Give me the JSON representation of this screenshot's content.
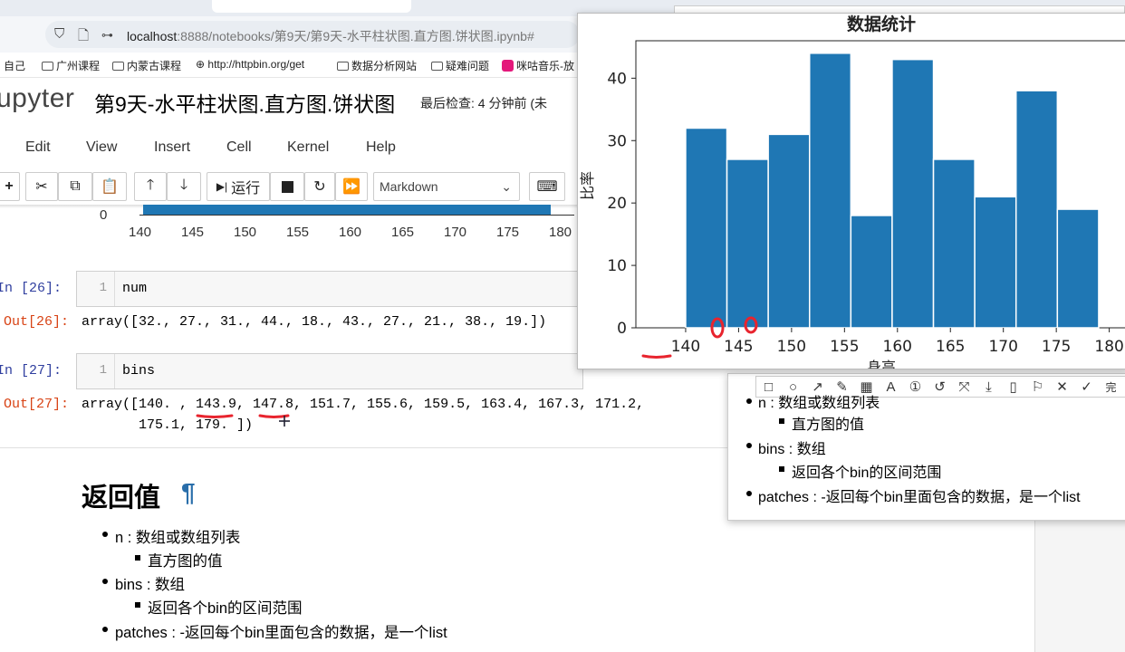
{
  "browser": {
    "url_host": "localhost",
    "url_rest": ":8888/notebooks/第9天/第9天-水平柱状图.直方图.饼状图.ipynb#",
    "bookmarks": [
      "自己",
      "广州课程",
      "内蒙古课程",
      "http://httpbin.org/get",
      "数据分析网站",
      "疑难问题",
      "咪咕音乐-放"
    ]
  },
  "jupyter": {
    "logo": "upyter",
    "title": "第9天-水平柱状图.直方图.饼状图",
    "checkpoint": "最后检查: 4 分钟前  (未",
    "menu": [
      "Edit",
      "View",
      "Insert",
      "Cell",
      "Kernel",
      "Help"
    ],
    "toolbar": {
      "run_label": "运行",
      "cell_type": "Markdown"
    }
  },
  "top_plot": {
    "zero_label": "0",
    "ticks": [
      "140",
      "145",
      "150",
      "155",
      "160",
      "165",
      "170",
      "175",
      "180"
    ]
  },
  "cells": [
    {
      "in_prompt": "In  [26]:",
      "line_no": "1",
      "code": "num",
      "out_prompt": "Out[26]:",
      "output": "array([32., 27., 31., 44., 18., 43., 27., 21., 38., 19.])"
    },
    {
      "in_prompt": "In  [27]:",
      "line_no": "1",
      "code": "bins",
      "out_prompt": "Out[27]:",
      "output_line1": "array([140. , 143.9, 147.8, 151.7, 155.6, 159.5, 163.4, 167.3, 171.2,",
      "output_line2": "       175.1, 179. ])"
    }
  ],
  "markdown": {
    "heading": "返回值",
    "pilcrow": "¶",
    "items": [
      {
        "term": "n : 数组或数组列表",
        "sub": "直方图的值"
      },
      {
        "term": "bins : 数组",
        "sub": "返回各个bin的区间范围"
      },
      {
        "term": "patches : -返回每个bin里面包含的数据，是一个list",
        "sub": ""
      }
    ]
  },
  "copy_window": {
    "items": [
      {
        "term": "n : 数组或数组列表",
        "sub": "直方图的值"
      },
      {
        "term": "bins : 数组",
        "sub": "返回各个bin的区间范围"
      },
      {
        "term": "patches : -返回每个bin里面包含的数据，是一个list",
        "sub": ""
      }
    ],
    "snip_done": "完"
  },
  "chart_data": {
    "type": "bar",
    "title": "数据统计",
    "xlabel": "身高",
    "ylabel": "比率",
    "bins": [
      140.0,
      143.9,
      147.8,
      151.7,
      155.6,
      159.5,
      163.4,
      167.3,
      171.2,
      175.1,
      179.0
    ],
    "values": [
      32,
      27,
      31,
      44,
      18,
      43,
      27,
      21,
      38,
      19
    ],
    "xlim": [
      135.3,
      182
    ],
    "ylim": [
      0,
      46
    ],
    "xticks": [
      140,
      145,
      150,
      155,
      160,
      165,
      170,
      175,
      180
    ],
    "yticks": [
      0,
      10,
      20,
      30,
      40
    ],
    "bar_color": "#1f77b4",
    "edge_color": "#ffffff"
  },
  "annotation_color": "#e8242e"
}
